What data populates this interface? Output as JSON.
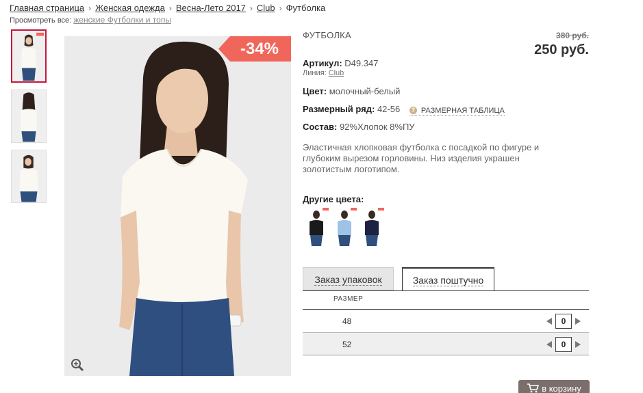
{
  "breadcrumb": {
    "items": [
      "Главная страница",
      "Женская одежда",
      "Весна-Лето 2017",
      "Club"
    ],
    "current": "Футболка",
    "separator": "›"
  },
  "view_all": {
    "label": "Просмотреть все:",
    "link": "женские Футболки и топы"
  },
  "product": {
    "discount_badge": "-34%",
    "title": "ФУТБОЛКА",
    "old_price": "380 руб.",
    "price": "250 руб.",
    "article_label": "Артикул:",
    "article_value": "D49.347",
    "line_label": "Линия:",
    "line_value": "Club",
    "color_label": "Цвет:",
    "color_value": "молочный-белый",
    "size_range_label": "Размерный ряд:",
    "size_range_value": "42-56",
    "size_chart_link": "РАЗМЕРНАЯ ТАБЛИЦА",
    "composition_label": "Состав:",
    "composition_value": "92%Хлопок 8%ПУ",
    "description": "Эластичная хлопковая футболка с посадкой по фигуре и глубоким вырезом горловины. Низ изделия украшен золотистым логотипом.",
    "other_colors_label": "Другие цвета:",
    "other_colors": [
      "black-tshirt",
      "lightblue-tshirt",
      "navy-tshirt"
    ]
  },
  "order": {
    "tab_packs": "Заказ упаковок",
    "tab_pieces": "Заказ поштучно",
    "size_header": "РАЗМЕР",
    "rows": [
      {
        "size": "48",
        "qty": "0"
      },
      {
        "size": "52",
        "qty": "0"
      }
    ],
    "cart_button": "в корзину"
  },
  "colors": {
    "accent_red": "#c7163a",
    "discount_bg": "#f1665a",
    "cart_bg": "#7a6f6c"
  }
}
